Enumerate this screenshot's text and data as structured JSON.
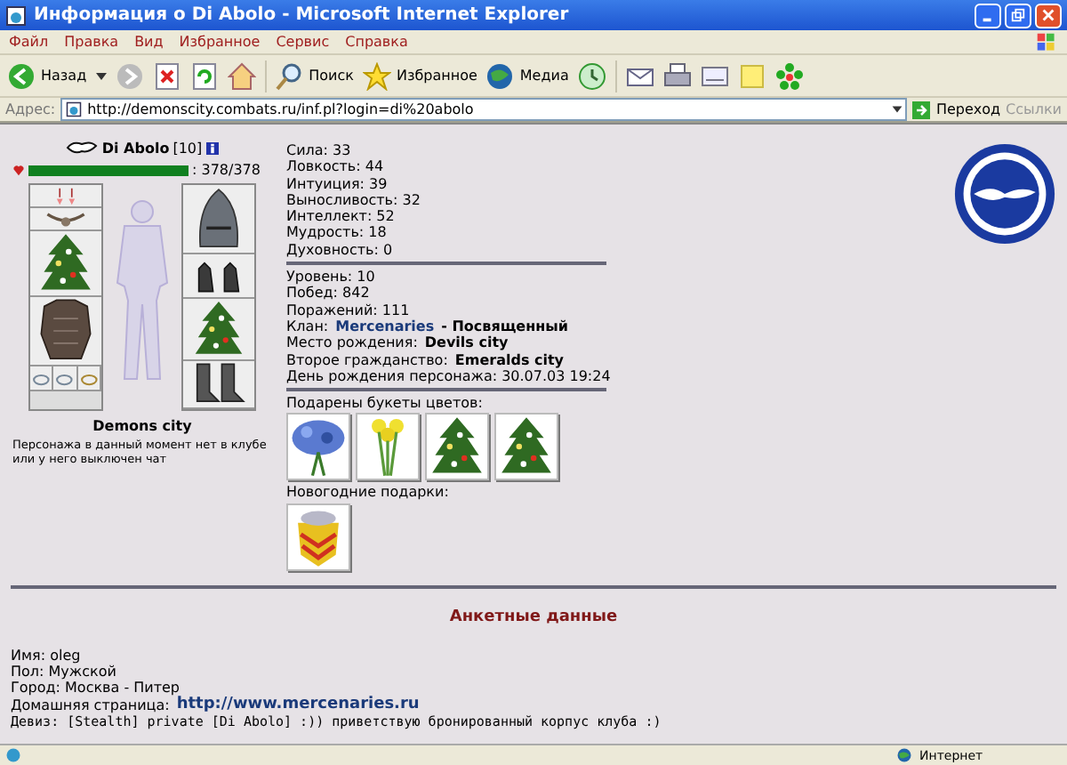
{
  "window": {
    "title": "Информация о Di Abolo - Microsoft Internet Explorer"
  },
  "menu": [
    "Файл",
    "Правка",
    "Вид",
    "Избранное",
    "Сервис",
    "Справка"
  ],
  "toolbar": {
    "back": "Назад",
    "search": "Поиск",
    "favorites": "Избранное",
    "media": "Медиа"
  },
  "address": {
    "label": "Адрес:",
    "url": "http://demonscity.combats.ru/inf.pl?login=di%20abolo",
    "go": "Переход",
    "links": "Ссылки"
  },
  "character": {
    "name": "Di Abolo",
    "level": "[10]",
    "hp_text": ": 378/378",
    "hp": {
      "level": 1
    },
    "city": "Demons city",
    "note": "Персонажа в данный момент нет в клубе или у него выключен чат"
  },
  "stats": [
    "Сила: 33",
    "Ловкость: 44",
    "Интуиция: 39",
    "Выносливость: 32",
    "Интеллект: 52",
    "Мудрость: 18",
    "Духовность: 0"
  ],
  "info": [
    {
      "label": "Уровень: 10"
    },
    {
      "label": "Побед: 842"
    },
    {
      "label": "Поражений: 111"
    },
    {
      "label": "Клан:",
      "link": "Mercenaries",
      "value": "- Посвященный"
    },
    {
      "label": "Место рождения:",
      "value": "Devils city"
    },
    {
      "label": "Второе гражданство:",
      "value": "Emeralds city"
    },
    {
      "label": "День рождения персонажа: 30.07.03 19:24"
    }
  ],
  "flowers": {
    "title": "Подарены букеты цветов:",
    "items": [
      {
        "kind": "cornflowers"
      },
      {
        "kind": "daffodils"
      },
      {
        "kind": "tree"
      },
      {
        "kind": "tree"
      }
    ]
  },
  "new_year": {
    "title": "Новогодние подарки:",
    "items": [
      {
        "kind": "gift"
      }
    ]
  },
  "profile": {
    "title": "Анкетные данные",
    "fields": [
      {
        "label": "Имя: oleg"
      },
      {
        "label": "Пол: Мужской"
      },
      {
        "label": "Город: Москва - Питер"
      },
      {
        "label": "Домашняя страница:",
        "link": "http://www.mercenaries.ru"
      },
      {
        "label": "Девиз: [Stealth] private [Di Abolo] :)) приветствую бронированный корпус клуба :)",
        "kind": "mono"
      }
    ]
  },
  "status_bar": {
    "zone": "Интернет"
  }
}
